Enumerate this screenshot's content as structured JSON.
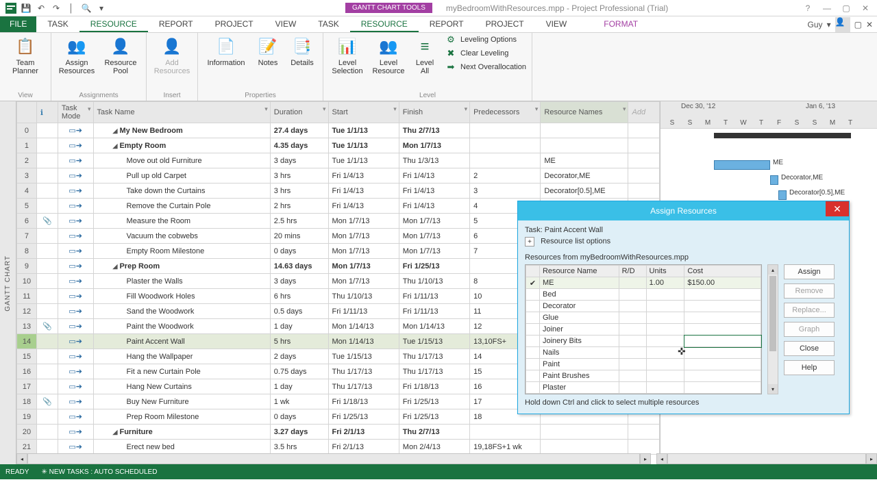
{
  "titlebar": {
    "contextual": "GANTT CHART TOOLS",
    "appname": "myBedroomWithResources.mpp - Project Professional (Trial)"
  },
  "tabs": {
    "file": "FILE",
    "items": [
      "TASK",
      "RESOURCE",
      "REPORT",
      "PROJECT",
      "VIEW"
    ],
    "contextual": "FORMAT",
    "active_index": 1,
    "user": "Guy"
  },
  "ribbon": {
    "view": {
      "team_planner": "Team\nPlanner",
      "label": "View"
    },
    "assignments": {
      "assign": "Assign\nResources",
      "pool": "Resource\nPool",
      "label": "Assignments"
    },
    "insert": {
      "add": "Add\nResources",
      "label": "Insert"
    },
    "properties": {
      "information": "Information",
      "notes": "Notes",
      "details": "Details",
      "label": "Properties"
    },
    "level": {
      "sel": "Level\nSelection",
      "res": "Level\nResource",
      "all": "Level\nAll",
      "opts": "Leveling Options",
      "clear": "Clear Leveling",
      "next": "Next Overallocation",
      "label": "Level"
    }
  },
  "columns": {
    "info": "",
    "mode": "Task\nMode",
    "name": "Task Name",
    "duration": "Duration",
    "start": "Start",
    "finish": "Finish",
    "pred": "Predecessors",
    "res": "Resource Names",
    "add": "Add"
  },
  "rows": [
    {
      "n": "0",
      "ind": "",
      "name": "My New Bedroom",
      "dur": "27.4 days",
      "start": "Tue 1/1/13",
      "finish": "Thu 2/7/13",
      "pred": "",
      "res": "",
      "bold": true,
      "caret": true,
      "indent": 1
    },
    {
      "n": "1",
      "ind": "",
      "name": "Empty Room",
      "dur": "4.35 days",
      "start": "Tue 1/1/13",
      "finish": "Mon 1/7/13",
      "pred": "",
      "res": "",
      "bold": true,
      "caret": true,
      "indent": 1
    },
    {
      "n": "2",
      "ind": "",
      "name": "Move out old Furniture",
      "dur": "3 days",
      "start": "Tue 1/1/13",
      "finish": "Thu 1/3/13",
      "pred": "",
      "res": "ME",
      "indent": 2
    },
    {
      "n": "3",
      "ind": "",
      "name": "Pull up old Carpet",
      "dur": "3 hrs",
      "start": "Fri 1/4/13",
      "finish": "Fri 1/4/13",
      "pred": "2",
      "res": "Decorator,ME",
      "indent": 2
    },
    {
      "n": "4",
      "ind": "",
      "name": "Take down the Curtains",
      "dur": "3 hrs",
      "start": "Fri 1/4/13",
      "finish": "Fri 1/4/13",
      "pred": "3",
      "res": "Decorator[0.5],ME",
      "indent": 2
    },
    {
      "n": "5",
      "ind": "",
      "name": "Remove the Curtain Pole",
      "dur": "2 hrs",
      "start": "Fri 1/4/13",
      "finish": "Fri 1/4/13",
      "pred": "4",
      "res": "",
      "indent": 2
    },
    {
      "n": "6",
      "ind": "📎",
      "name": "Measure the Room",
      "dur": "2.5 hrs",
      "start": "Mon 1/7/13",
      "finish": "Mon 1/7/13",
      "pred": "5",
      "res": "",
      "indent": 2
    },
    {
      "n": "7",
      "ind": "",
      "name": "Vacuum the cobwebs",
      "dur": "20 mins",
      "start": "Mon 1/7/13",
      "finish": "Mon 1/7/13",
      "pred": "6",
      "res": "",
      "indent": 2
    },
    {
      "n": "8",
      "ind": "",
      "name": "Empty Room Milestone",
      "dur": "0 days",
      "start": "Mon 1/7/13",
      "finish": "Mon 1/7/13",
      "pred": "7",
      "res": "",
      "indent": 2
    },
    {
      "n": "9",
      "ind": "",
      "name": "Prep Room",
      "dur": "14.63 days",
      "start": "Mon 1/7/13",
      "finish": "Fri 1/25/13",
      "pred": "",
      "res": "",
      "bold": true,
      "caret": true,
      "indent": 1
    },
    {
      "n": "10",
      "ind": "",
      "name": "Plaster the Walls",
      "dur": "3 days",
      "start": "Mon 1/7/13",
      "finish": "Thu 1/10/13",
      "pred": "8",
      "res": "",
      "indent": 2
    },
    {
      "n": "11",
      "ind": "",
      "name": "Fill Woodwork Holes",
      "dur": "6 hrs",
      "start": "Thu 1/10/13",
      "finish": "Fri 1/11/13",
      "pred": "10",
      "res": "",
      "indent": 2
    },
    {
      "n": "12",
      "ind": "",
      "name": "Sand the Woodwork",
      "dur": "0.5 days",
      "start": "Fri 1/11/13",
      "finish": "Fri 1/11/13",
      "pred": "11",
      "res": "",
      "indent": 2
    },
    {
      "n": "13",
      "ind": "📎",
      "name": "Paint the Woodwork",
      "dur": "1 day",
      "start": "Mon 1/14/13",
      "finish": "Mon 1/14/13",
      "pred": "12",
      "res": "",
      "indent": 2
    },
    {
      "n": "14",
      "ind": "",
      "name": "Paint Accent Wall",
      "dur": "5 hrs",
      "start": "Mon 1/14/13",
      "finish": "Tue 1/15/13",
      "pred": "13,10FS+",
      "res": "",
      "indent": 2,
      "selected": true
    },
    {
      "n": "15",
      "ind": "",
      "name": "Hang the Wallpaper",
      "dur": "2 days",
      "start": "Tue 1/15/13",
      "finish": "Thu 1/17/13",
      "pred": "14",
      "res": "",
      "indent": 2
    },
    {
      "n": "16",
      "ind": "",
      "name": "Fit a new Curtain Pole",
      "dur": "0.75 days",
      "start": "Thu 1/17/13",
      "finish": "Thu 1/17/13",
      "pred": "15",
      "res": "",
      "indent": 2
    },
    {
      "n": "17",
      "ind": "",
      "name": "Hang New Curtains",
      "dur": "1 day",
      "start": "Thu 1/17/13",
      "finish": "Fri 1/18/13",
      "pred": "16",
      "res": "",
      "indent": 2
    },
    {
      "n": "18",
      "ind": "📎",
      "name": "Buy New Furniture",
      "dur": "1 wk",
      "start": "Fri 1/18/13",
      "finish": "Fri 1/25/13",
      "pred": "17",
      "res": "",
      "indent": 2
    },
    {
      "n": "19",
      "ind": "",
      "name": "Prep Room Milestone",
      "dur": "0 days",
      "start": "Fri 1/25/13",
      "finish": "Fri 1/25/13",
      "pred": "18",
      "res": "",
      "indent": 2
    },
    {
      "n": "20",
      "ind": "",
      "name": "Furniture",
      "dur": "3.27 days",
      "start": "Fri 2/1/13",
      "finish": "Thu 2/7/13",
      "pred": "",
      "res": "",
      "bold": true,
      "caret": true,
      "indent": 1
    },
    {
      "n": "21",
      "ind": "",
      "name": "Erect new bed",
      "dur": "3.5 hrs",
      "start": "Fri 2/1/13",
      "finish": "Mon 2/4/13",
      "pred": "19,18FS+1 wk",
      "res": "",
      "indent": 2
    }
  ],
  "gantt": {
    "week1": "Dec 30, '12",
    "week2": "Jan 6, '13",
    "days": [
      "S",
      "S",
      "M",
      "T",
      "W",
      "T",
      "F",
      "S",
      "S",
      "M",
      "T"
    ],
    "labels": {
      "r2": "ME",
      "r3": "Decorator,ME",
      "r4": "Decorator[0.5],ME"
    }
  },
  "dialog": {
    "title": "Assign Resources",
    "task": "Task: Paint Accent Wall",
    "list_opts": "Resource list options",
    "from": "Resources from myBedroomWithResources.mpp",
    "cols": {
      "name": "Resource Name",
      "rd": "R/D",
      "units": "Units",
      "cost": "Cost"
    },
    "rows": [
      {
        "chk": "✔",
        "name": "ME",
        "rd": "",
        "units": "1.00",
        "cost": "$150.00",
        "sel": true
      },
      {
        "chk": "",
        "name": "Bed",
        "rd": "",
        "units": "",
        "cost": ""
      },
      {
        "chk": "",
        "name": "Decorator",
        "rd": "",
        "units": "",
        "cost": ""
      },
      {
        "chk": "",
        "name": "Glue",
        "rd": "",
        "units": "",
        "cost": ""
      },
      {
        "chk": "",
        "name": "Joiner",
        "rd": "",
        "units": "",
        "cost": ""
      },
      {
        "chk": "",
        "name": "Joinery Bits",
        "rd": "",
        "units": "",
        "cost": "",
        "active": true
      },
      {
        "chk": "",
        "name": "Nails",
        "rd": "",
        "units": "",
        "cost": ""
      },
      {
        "chk": "",
        "name": "Paint",
        "rd": "",
        "units": "",
        "cost": ""
      },
      {
        "chk": "",
        "name": "Paint Brushes",
        "rd": "",
        "units": "",
        "cost": ""
      },
      {
        "chk": "",
        "name": "Plaster",
        "rd": "",
        "units": "",
        "cost": ""
      }
    ],
    "buttons": {
      "assign": "Assign",
      "remove": "Remove",
      "replace": "Replace...",
      "graph": "Graph",
      "close": "Close",
      "help": "Help"
    },
    "hint": "Hold down Ctrl and click to select multiple resources"
  },
  "status": {
    "ready": "READY",
    "newtasks": "NEW TASKS : AUTO SCHEDULED"
  },
  "side_label": "GANTT CHART"
}
